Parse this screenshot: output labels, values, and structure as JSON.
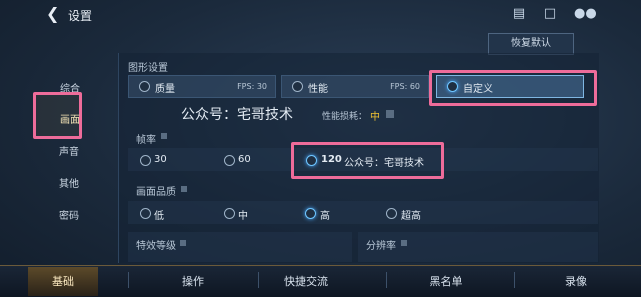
{
  "header": {
    "back_icon": "chevron-left-icon",
    "title": "设置"
  },
  "top_icons": [
    "clipboard-icon",
    "chat-icon",
    "friends-icon"
  ],
  "restore_label": "恢复默认",
  "side_nav": [
    "综合",
    "画面",
    "声音",
    "其他",
    "密码"
  ],
  "graphics": {
    "section_label": "图形设置",
    "options": [
      {
        "label": "质量",
        "fps": "FPS: 30"
      },
      {
        "label": "性能",
        "fps": "FPS: 60"
      },
      {
        "label": "自定义",
        "fps": ""
      }
    ]
  },
  "watermark_top": "公众号：宅哥技术",
  "perf_cost_label": "性能损耗：",
  "perf_cost_value": "中",
  "frame_rate": {
    "label": "帧率",
    "options": [
      "30",
      "60",
      "120"
    ],
    "watermark": "公众号：宅哥技术"
  },
  "quality": {
    "label": "画面品质",
    "options": [
      "低",
      "中",
      "高",
      "超高"
    ]
  },
  "effects_label": "特效等级",
  "resolution_label": "分辨率",
  "bottom_tabs": [
    "基础",
    "操作",
    "快捷交流",
    "黑名单",
    "录像"
  ],
  "accent_color": "#ee6c9a"
}
